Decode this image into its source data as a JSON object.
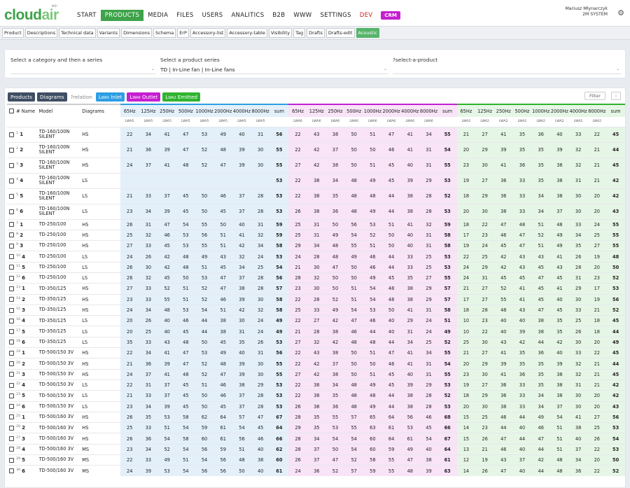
{
  "app": {
    "logo_a": "cloud",
    "logo_b": "air",
    "logo_tm": "tech",
    "user_name": "Mariusz Młynarczyk",
    "user_role": "2M SYSTEM"
  },
  "nav": [
    {
      "label": "START",
      "active": false
    },
    {
      "label": "PRODUCTS",
      "active": true
    },
    {
      "label": "MEDIA",
      "active": false
    },
    {
      "label": "FILES",
      "active": false
    },
    {
      "label": "USERS",
      "active": false
    },
    {
      "label": "ANALITICS",
      "active": false
    },
    {
      "label": "B2B",
      "active": false
    },
    {
      "label": "WWW",
      "active": false
    },
    {
      "label": "SETTINGS",
      "active": false
    },
    {
      "label": "DEV",
      "active": false,
      "dev": true
    }
  ],
  "crm_label": "CRM",
  "subnav": [
    "Product",
    "Descriptions",
    "Technical data",
    "Variants",
    "Dimensions",
    "Schema",
    "ErP",
    "Accessory-list",
    "Accessory-table",
    "Visibility",
    "Tag",
    "Drafts",
    "Drafts-edit",
    "Acoustic"
  ],
  "subnav_active": "Acoustic",
  "filters": {
    "category_label": "Select a category and then a series",
    "category_value": "",
    "product_label": "Select a product series",
    "product_value": "TD | In-Line fan | In-Line fans",
    "select_product_label": "?select-a-product",
    "select_product_value": ""
  },
  "toolbar": {
    "products": "Products",
    "diagrams": "Diagrams",
    "relation": "?relation",
    "inlet": "L",
    "inlet_sub": "WA5",
    "inlet_txt": " Inlet",
    "outlet": "L",
    "outlet_sub": "WA6",
    "outlet_txt": " Outlet",
    "emitted": "L",
    "emitted_sub": "WA2",
    "emitted_txt": " Emitted",
    "filter": "Filter",
    "dots": "⋮"
  },
  "columns": {
    "hash": "#",
    "name": "Name",
    "model": "Model",
    "diagrams": "Diagrams",
    "freqs": [
      "65Hz",
      "125Hz",
      "250Hz",
      "500Hz",
      "1000Hz",
      "2000Hz",
      "4000Hz",
      "8000Hz",
      "sum"
    ],
    "sub_inlet": "LWA5",
    "sub_outlet": "LWA6",
    "sub_emitted": "LWA2"
  },
  "colors": {
    "inlet": "#2d9ee3",
    "outlet": "#c51fd0",
    "emitted": "#2fb42f",
    "brand": "#3ea34a"
  },
  "rows": [
    {
      "i": "1",
      "n": "1",
      "m": "TD-160/100N SILENT",
      "d": "HS",
      "a": [
        22,
        34,
        41,
        47,
        53,
        49,
        40,
        31,
        56
      ],
      "b": [
        22,
        43,
        38,
        50,
        51,
        47,
        41,
        34,
        55
      ],
      "c": [
        21,
        27,
        41,
        35,
        36,
        40,
        33,
        22,
        45
      ]
    },
    {
      "i": "2",
      "n": "2",
      "m": "TD-160/100N SILENT",
      "d": "HS",
      "a": [
        21,
        36,
        39,
        47,
        52,
        48,
        39,
        30,
        55
      ],
      "b": [
        22,
        42,
        37,
        50,
        50,
        46,
        41,
        31,
        54
      ],
      "c": [
        20,
        29,
        39,
        35,
        35,
        39,
        32,
        21,
        44
      ]
    },
    {
      "i": "3",
      "n": "3",
      "m": "TD-160/100N SILENT",
      "d": "HS",
      "a": [
        24,
        37,
        41,
        48,
        52,
        47,
        39,
        30,
        55
      ],
      "b": [
        27,
        42,
        38,
        50,
        51,
        45,
        40,
        31,
        55
      ],
      "c": [
        23,
        30,
        41,
        36,
        35,
        38,
        32,
        21,
        45
      ]
    },
    {
      "i": "4",
      "n": "4",
      "m": "TD-160/100N SILENT",
      "d": "LS",
      "a": [
        "",
        "",
        "",
        "",
        "",
        "",
        "",
        "",
        53
      ],
      "b": [
        22,
        38,
        34,
        48,
        49,
        45,
        39,
        29,
        53
      ],
      "c": [
        19,
        27,
        36,
        33,
        35,
        38,
        31,
        21,
        42
      ]
    },
    {
      "i": "5",
      "n": "5",
      "m": "TD-160/100N SILENT",
      "d": "LS",
      "a": [
        21,
        33,
        37,
        45,
        50,
        46,
        37,
        28,
        53
      ],
      "b": [
        22,
        38,
        35,
        48,
        48,
        44,
        38,
        28,
        52
      ],
      "c": [
        18,
        29,
        36,
        33,
        34,
        38,
        30,
        20,
        42
      ]
    },
    {
      "i": "6",
      "n": "6",
      "m": "TD-160/100N SILENT",
      "d": "LS",
      "a": [
        23,
        34,
        39,
        45,
        50,
        45,
        37,
        28,
        53
      ],
      "b": [
        26,
        38,
        36,
        48,
        49,
        44,
        38,
        28,
        53
      ],
      "c": [
        20,
        30,
        38,
        33,
        34,
        37,
        30,
        20,
        43
      ]
    },
    {
      "i": "7",
      "n": "1",
      "m": "TD-250/100",
      "d": "HS",
      "a": [
        26,
        31,
        47,
        54,
        55,
        50,
        40,
        31,
        59
      ],
      "b": [
        25,
        31,
        50,
        56,
        53,
        51,
        41,
        32,
        59
      ],
      "c": [
        18,
        22,
        47,
        48,
        51,
        48,
        33,
        24,
        55
      ]
    },
    {
      "i": "8",
      "n": "2",
      "m": "TD-250/100",
      "d": "HS",
      "a": [
        25,
        32,
        46,
        53,
        56,
        51,
        41,
        32,
        59
      ],
      "b": [
        25,
        31,
        49,
        54,
        52,
        50,
        40,
        31,
        58
      ],
      "c": [
        17,
        23,
        46,
        47,
        52,
        49,
        34,
        25,
        55
      ]
    },
    {
      "i": "9",
      "n": "3",
      "m": "TD-250/100",
      "d": "HS",
      "a": [
        27,
        33,
        45,
        53,
        55,
        51,
        42,
        34,
        58
      ],
      "b": [
        29,
        34,
        48,
        55,
        51,
        50,
        40,
        31,
        58
      ],
      "c": [
        19,
        24,
        45,
        47,
        51,
        49,
        35,
        27,
        55
      ]
    },
    {
      "i": "10",
      "n": "4",
      "m": "TD-250/100",
      "d": "LS",
      "a": [
        24,
        26,
        42,
        48,
        49,
        43,
        32,
        24,
        53
      ],
      "b": [
        24,
        28,
        48,
        49,
        46,
        44,
        33,
        25,
        53
      ],
      "c": [
        22,
        25,
        42,
        43,
        43,
        41,
        26,
        19,
        48
      ]
    },
    {
      "i": "11",
      "n": "5",
      "m": "TD-250/100",
      "d": "LS",
      "a": [
        26,
        30,
        42,
        48,
        51,
        45,
        34,
        25,
        54
      ],
      "b": [
        21,
        30,
        47,
        50,
        46,
        44,
        33,
        25,
        53
      ],
      "c": [
        24,
        29,
        42,
        43,
        45,
        43,
        28,
        20,
        50
      ]
    },
    {
      "i": "12",
      "n": "6",
      "m": "TD-250/100",
      "d": "LS",
      "a": [
        26,
        32,
        45,
        50,
        53,
        47,
        37,
        28,
        56
      ],
      "b": [
        28,
        32,
        50,
        50,
        49,
        45,
        35,
        27,
        55
      ],
      "c": [
        24,
        31,
        45,
        45,
        47,
        45,
        31,
        23,
        52
      ]
    },
    {
      "i": "13",
      "n": "1",
      "m": "TD-350/125",
      "d": "HS",
      "a": [
        27,
        33,
        52,
        51,
        52,
        47,
        38,
        28,
        57
      ],
      "b": [
        23,
        30,
        50,
        51,
        54,
        48,
        38,
        29,
        57
      ],
      "c": [
        21,
        27,
        52,
        41,
        45,
        41,
        29,
        17,
        53
      ]
    },
    {
      "i": "14",
      "n": "2",
      "m": "TD-350/125",
      "d": "HS",
      "a": [
        23,
        33,
        55,
        51,
        52,
        46,
        39,
        30,
        58
      ],
      "b": [
        22,
        28,
        52,
        51,
        54,
        48,
        38,
        29,
        57
      ],
      "c": [
        17,
        27,
        55,
        41,
        45,
        40,
        30,
        19,
        56
      ]
    },
    {
      "i": "15",
      "n": "3",
      "m": "TD-350/125",
      "d": "HS",
      "a": [
        24,
        34,
        48,
        53,
        54,
        51,
        42,
        32,
        58
      ],
      "b": [
        25,
        33,
        49,
        54,
        53,
        50,
        41,
        31,
        58
      ],
      "c": [
        18,
        28,
        48,
        43,
        47,
        45,
        33,
        21,
        52
      ]
    },
    {
      "i": "16",
      "n": "4",
      "m": "TD-350/125",
      "d": "LS",
      "a": [
        20,
        26,
        40,
        46,
        44,
        38,
        30,
        24,
        49
      ],
      "b": [
        22,
        27,
        42,
        47,
        46,
        40,
        29,
        24,
        51
      ],
      "c": [
        10,
        23,
        40,
        40,
        38,
        35,
        25,
        18,
        45
      ]
    },
    {
      "i": "17",
      "n": "5",
      "m": "TD-350/125",
      "d": "LS",
      "a": [
        20,
        25,
        40,
        45,
        44,
        38,
        31,
        24,
        49
      ],
      "b": [
        21,
        28,
        38,
        46,
        44,
        40,
        31,
        24,
        49
      ],
      "c": [
        10,
        22,
        40,
        39,
        38,
        35,
        26,
        18,
        44
      ]
    },
    {
      "i": "18",
      "n": "6",
      "m": "TD-350/125",
      "d": "LS",
      "a": [
        35,
        33,
        43,
        48,
        50,
        45,
        35,
        26,
        53
      ],
      "b": [
        27,
        32,
        42,
        48,
        48,
        44,
        34,
        25,
        52
      ],
      "c": [
        25,
        30,
        43,
        42,
        44,
        42,
        30,
        20,
        49
      ]
    },
    {
      "i": "19",
      "n": "1",
      "m": "TD-500/150 3V",
      "d": "HS",
      "a": [
        22,
        34,
        41,
        47,
        53,
        49,
        40,
        31,
        56
      ],
      "b": [
        22,
        43,
        38,
        50,
        51,
        47,
        41,
        34,
        55
      ],
      "c": [
        21,
        27,
        41,
        35,
        36,
        40,
        33,
        22,
        45
      ]
    },
    {
      "i": "20",
      "n": "2",
      "m": "TD-500/150 3V",
      "d": "HS",
      "a": [
        21,
        36,
        39,
        47,
        52,
        48,
        39,
        30,
        55
      ],
      "b": [
        22,
        42,
        37,
        50,
        50,
        46,
        41,
        31,
        54
      ],
      "c": [
        20,
        29,
        39,
        35,
        35,
        39,
        32,
        21,
        44
      ]
    },
    {
      "i": "21",
      "n": "3",
      "m": "TD-500/150 3V",
      "d": "HS",
      "a": [
        24,
        37,
        41,
        48,
        52,
        47,
        39,
        30,
        55
      ],
      "b": [
        27,
        42,
        38,
        50,
        51,
        45,
        40,
        31,
        55
      ],
      "c": [
        23,
        30,
        41,
        36,
        35,
        38,
        32,
        21,
        45
      ]
    },
    {
      "i": "22",
      "n": "4",
      "m": "TD-500/150 3V",
      "d": "LS",
      "a": [
        22,
        31,
        37,
        45,
        51,
        46,
        38,
        29,
        53
      ],
      "b": [
        22,
        38,
        34,
        48,
        49,
        45,
        39,
        29,
        53
      ],
      "c": [
        19,
        27,
        36,
        33,
        35,
        38,
        31,
        21,
        42
      ]
    },
    {
      "i": "23",
      "n": "5",
      "m": "TD-500/150 3V",
      "d": "LS",
      "a": [
        21,
        33,
        37,
        45,
        50,
        46,
        37,
        28,
        53
      ],
      "b": [
        22,
        38,
        35,
        48,
        48,
        44,
        38,
        28,
        52
      ],
      "c": [
        18,
        29,
        36,
        33,
        34,
        38,
        30,
        20,
        42
      ]
    },
    {
      "i": "24",
      "n": "6",
      "m": "TD-500/150 3V",
      "d": "LS",
      "a": [
        23,
        34,
        39,
        45,
        50,
        45,
        37,
        28,
        53
      ],
      "b": [
        26,
        38,
        36,
        48,
        49,
        44,
        38,
        28,
        53
      ],
      "c": [
        20,
        30,
        38,
        33,
        34,
        37,
        30,
        20,
        43
      ]
    },
    {
      "i": "25",
      "n": "1",
      "m": "TD-500/160 3V",
      "d": "HS",
      "a": [
        26,
        35,
        53,
        58,
        62,
        64,
        57,
        47,
        67
      ],
      "b": [
        28,
        35,
        55,
        57,
        65,
        64,
        56,
        46,
        68
      ],
      "c": [
        15,
        25,
        46,
        44,
        49,
        54,
        41,
        27,
        56
      ]
    },
    {
      "i": "26",
      "n": "2",
      "m": "TD-500/160 3V",
      "d": "HS",
      "a": [
        25,
        33,
        51,
        54,
        59,
        61,
        54,
        45,
        64
      ],
      "b": [
        29,
        35,
        53,
        55,
        63,
        61,
        53,
        45,
        66
      ],
      "c": [
        14,
        23,
        44,
        40,
        46,
        51,
        38,
        25,
        53
      ]
    },
    {
      "i": "27",
      "n": "3",
      "m": "TD-500/160 3V",
      "d": "HS",
      "a": [
        26,
        36,
        54,
        58,
        60,
        61,
        56,
        46,
        66
      ],
      "b": [
        28,
        34,
        54,
        54,
        60,
        64,
        61,
        54,
        67
      ],
      "c": [
        15,
        26,
        47,
        44,
        47,
        51,
        40,
        26,
        54
      ]
    },
    {
      "i": "28",
      "n": "4",
      "m": "TD-500/160 3V",
      "d": "MS",
      "a": [
        23,
        34,
        52,
        54,
        56,
        59,
        51,
        40,
        62
      ],
      "b": [
        28,
        37,
        50,
        54,
        60,
        59,
        49,
        40,
        64
      ],
      "c": [
        13,
        21,
        46,
        40,
        44,
        51,
        37,
        22,
        53
      ]
    },
    {
      "i": "29",
      "n": "5",
      "m": "TD-500/160 3V",
      "d": "MS",
      "a": [
        22,
        33,
        49,
        51,
        54,
        56,
        48,
        38,
        60
      ],
      "b": [
        26,
        37,
        47,
        52,
        58,
        55,
        47,
        38,
        61
      ],
      "c": [
        12,
        19,
        43,
        37,
        42,
        48,
        34,
        20,
        50
      ]
    },
    {
      "i": "30",
      "n": "6",
      "m": "TD-500/160 3V",
      "d": "MS",
      "a": [
        24,
        39,
        53,
        54,
        56,
        56,
        50,
        40,
        61
      ],
      "b": [
        24,
        36,
        52,
        57,
        59,
        55,
        48,
        39,
        63
      ],
      "c": [
        14,
        26,
        47,
        40,
        44,
        48,
        36,
        22,
        52
      ]
    }
  ]
}
